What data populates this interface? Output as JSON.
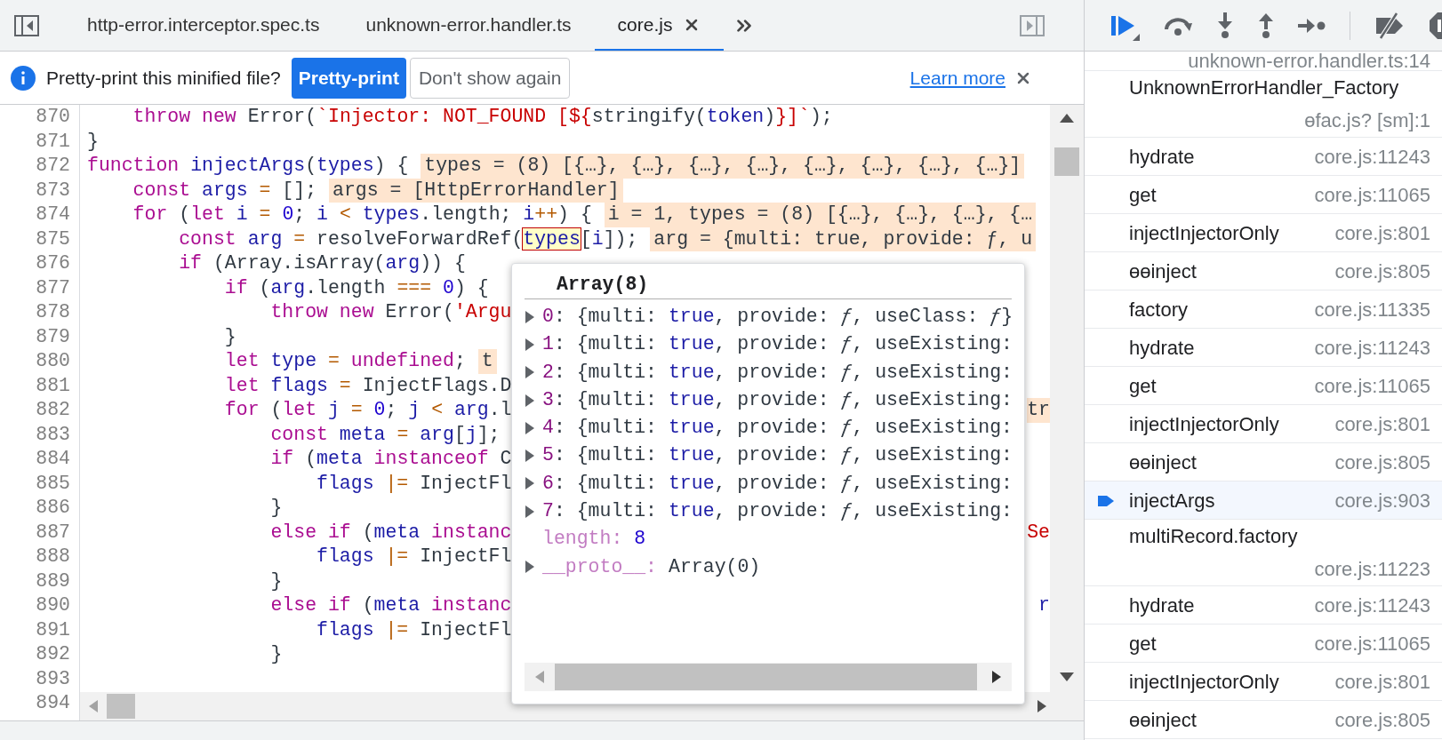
{
  "tabs": [
    {
      "label": "http-error.interceptor.spec.ts",
      "selected": false,
      "closable": false
    },
    {
      "label": "unknown-error.handler.ts",
      "selected": false,
      "closable": false
    },
    {
      "label": "core.js",
      "selected": true,
      "closable": true
    }
  ],
  "infobar": {
    "message": "Pretty-print this minified file?",
    "primary_button": "Pretty-print",
    "secondary_button": "Don't show again",
    "link": "Learn more"
  },
  "code": {
    "lines": [
      {
        "number": "870",
        "tokens": [
          {
            "kind": "k",
            "text": "    throw "
          },
          {
            "kind": "k",
            "text": "new"
          },
          {
            "kind": "p",
            "text": " Error("
          },
          {
            "kind": "s",
            "text": "`Injector: NOT_FOUND [${"
          },
          {
            "kind": "p",
            "text": "stringify("
          },
          {
            "kind": "v",
            "text": "token"
          },
          {
            "kind": "p",
            "text": ")"
          },
          {
            "kind": "s",
            "text": "}]`"
          },
          {
            "kind": "p",
            "text": ");"
          }
        ]
      },
      {
        "number": "871",
        "tokens": [
          {
            "kind": "p",
            "text": "}"
          }
        ]
      },
      {
        "number": "872",
        "tokens": [
          {
            "kind": "k",
            "text": "function "
          },
          {
            "kind": "v",
            "text": "injectArgs"
          },
          {
            "kind": "p",
            "text": "("
          },
          {
            "kind": "v",
            "text": "types"
          },
          {
            "kind": "p",
            "text": ") {"
          }
        ],
        "inline": "types = (8) [{…}, {…}, {…}, {…}, {…}, {…}, {…}, {…}]"
      },
      {
        "number": "873",
        "tokens": [
          {
            "kind": "k",
            "text": "    const "
          },
          {
            "kind": "v",
            "text": "args "
          },
          {
            "kind": "o",
            "text": "="
          },
          {
            "kind": "p",
            "text": " [];"
          }
        ],
        "inline": "args = [HttpErrorHandler]"
      },
      {
        "number": "874",
        "tokens": [
          {
            "kind": "k",
            "text": "    for"
          },
          {
            "kind": "p",
            "text": " ("
          },
          {
            "kind": "k",
            "text": "let "
          },
          {
            "kind": "v",
            "text": "i "
          },
          {
            "kind": "o",
            "text": "= "
          },
          {
            "kind": "n",
            "text": "0"
          },
          {
            "kind": "p",
            "text": "; "
          },
          {
            "kind": "v",
            "text": "i "
          },
          {
            "kind": "o",
            "text": "< "
          },
          {
            "kind": "v",
            "text": "types"
          },
          {
            "kind": "p",
            "text": ".length; "
          },
          {
            "kind": "v",
            "text": "i"
          },
          {
            "kind": "o",
            "text": "++"
          },
          {
            "kind": "p",
            "text": ") {"
          }
        ],
        "inline": "i = 1, types = (8) [{…}, {…}, {…}, {…"
      },
      {
        "number": "875",
        "tokens": [
          {
            "kind": "k",
            "text": "        const "
          },
          {
            "kind": "v",
            "text": "arg "
          },
          {
            "kind": "o",
            "text": "="
          },
          {
            "kind": "p",
            "text": " resolveForwardRef("
          },
          {
            "kind": "h",
            "text": "types"
          },
          {
            "kind": "p",
            "text": "["
          },
          {
            "kind": "v",
            "text": "i"
          },
          {
            "kind": "p",
            "text": "]);"
          }
        ],
        "inline": "arg = {multi: true, provide: ƒ, u"
      },
      {
        "number": "876",
        "tokens": [
          {
            "kind": "k",
            "text": "        if"
          },
          {
            "kind": "p",
            "text": " (Array.isArray("
          },
          {
            "kind": "v",
            "text": "arg"
          },
          {
            "kind": "p",
            "text": ")) {"
          }
        ]
      },
      {
        "number": "877",
        "tokens": [
          {
            "kind": "k",
            "text": "            if"
          },
          {
            "kind": "p",
            "text": " ("
          },
          {
            "kind": "v",
            "text": "arg"
          },
          {
            "kind": "p",
            "text": ".length "
          },
          {
            "kind": "o",
            "text": "=== "
          },
          {
            "kind": "n",
            "text": "0"
          },
          {
            "kind": "p",
            "text": ") {"
          }
        ]
      },
      {
        "number": "878",
        "tokens": [
          {
            "kind": "k",
            "text": "                throw "
          },
          {
            "kind": "k",
            "text": "new"
          },
          {
            "kind": "p",
            "text": " Error("
          },
          {
            "kind": "s",
            "text": "'Argu"
          }
        ]
      },
      {
        "number": "879",
        "tokens": [
          {
            "kind": "p",
            "text": "            }"
          }
        ]
      },
      {
        "number": "880",
        "tokens": [
          {
            "kind": "k",
            "text": "            let "
          },
          {
            "kind": "v",
            "text": "type "
          },
          {
            "kind": "o",
            "text": "= "
          },
          {
            "kind": "k",
            "text": "undefined"
          },
          {
            "kind": "p",
            "text": ";"
          }
        ],
        "inline": "t"
      },
      {
        "number": "881",
        "tokens": [
          {
            "kind": "k",
            "text": "            let "
          },
          {
            "kind": "v",
            "text": "flags "
          },
          {
            "kind": "o",
            "text": "="
          },
          {
            "kind": "p",
            "text": " InjectFlags.D"
          }
        ]
      },
      {
        "number": "882",
        "tokens": [
          {
            "kind": "k",
            "text": "            for"
          },
          {
            "kind": "p",
            "text": " ("
          },
          {
            "kind": "k",
            "text": "let "
          },
          {
            "kind": "v",
            "text": "j "
          },
          {
            "kind": "o",
            "text": "= "
          },
          {
            "kind": "n",
            "text": "0"
          },
          {
            "kind": "p",
            "text": "; "
          },
          {
            "kind": "v",
            "text": "j "
          },
          {
            "kind": "o",
            "text": "< "
          },
          {
            "kind": "v",
            "text": "arg"
          },
          {
            "kind": "p",
            "text": ".l"
          }
        ],
        "tail": {
          "kind": "i",
          "text": "tr"
        }
      },
      {
        "number": "883",
        "tokens": [
          {
            "kind": "k",
            "text": "                const "
          },
          {
            "kind": "v",
            "text": "meta "
          },
          {
            "kind": "o",
            "text": "= "
          },
          {
            "kind": "v",
            "text": "arg"
          },
          {
            "kind": "p",
            "text": "["
          },
          {
            "kind": "v",
            "text": "j"
          },
          {
            "kind": "p",
            "text": "];"
          }
        ]
      },
      {
        "number": "884",
        "tokens": [
          {
            "kind": "k",
            "text": "                if"
          },
          {
            "kind": "p",
            "text": " ("
          },
          {
            "kind": "v",
            "text": "meta "
          },
          {
            "kind": "k",
            "text": "instanceof"
          },
          {
            "kind": "p",
            "text": " C"
          }
        ]
      },
      {
        "number": "885",
        "tokens": [
          {
            "kind": "v",
            "text": "                    flags "
          },
          {
            "kind": "o",
            "text": "|="
          },
          {
            "kind": "p",
            "text": " InjectFl"
          }
        ]
      },
      {
        "number": "886",
        "tokens": [
          {
            "kind": "p",
            "text": "                }"
          }
        ]
      },
      {
        "number": "887",
        "tokens": [
          {
            "kind": "k",
            "text": "                else if"
          },
          {
            "kind": "p",
            "text": " ("
          },
          {
            "kind": "v",
            "text": "meta "
          },
          {
            "kind": "k",
            "text": "instanc"
          }
        ],
        "tail": {
          "kind": "s",
          "text": "Se"
        }
      },
      {
        "number": "888",
        "tokens": [
          {
            "kind": "v",
            "text": "                    flags "
          },
          {
            "kind": "o",
            "text": "|="
          },
          {
            "kind": "p",
            "text": " InjectFl"
          }
        ]
      },
      {
        "number": "889",
        "tokens": [
          {
            "kind": "p",
            "text": "                }"
          }
        ]
      },
      {
        "number": "890",
        "tokens": [
          {
            "kind": "k",
            "text": "                else if"
          },
          {
            "kind": "p",
            "text": " ("
          },
          {
            "kind": "v",
            "text": "meta "
          },
          {
            "kind": "k",
            "text": "instanc"
          }
        ],
        "tail": {
          "kind": "v",
          "text": "r"
        }
      },
      {
        "number": "891",
        "tokens": [
          {
            "kind": "v",
            "text": "                    flags "
          },
          {
            "kind": "o",
            "text": "|="
          },
          {
            "kind": "p",
            "text": " InjectFl"
          }
        ]
      },
      {
        "number": "892",
        "tokens": [
          {
            "kind": "p",
            "text": "                }"
          }
        ]
      },
      {
        "number": "893"
      },
      {
        "number": "894"
      }
    ]
  },
  "popup": {
    "title": "Array(8)",
    "entries": [
      {
        "key": "0",
        "expanded": false,
        "tokens": [
          {
            "kind": "p",
            "text": ": {multi: "
          },
          {
            "kind": "b",
            "text": "true"
          },
          {
            "kind": "p",
            "text": ", provide: "
          },
          {
            "kind": "f",
            "text": "ƒ"
          },
          {
            "kind": "p",
            "text": ", useClass: "
          },
          {
            "kind": "f",
            "text": "ƒ"
          },
          {
            "kind": "p",
            "text": "}"
          }
        ]
      },
      {
        "key": "1",
        "expanded": false,
        "tokens": [
          {
            "kind": "p",
            "text": ": {multi: "
          },
          {
            "kind": "b",
            "text": "true"
          },
          {
            "kind": "p",
            "text": ", provide: "
          },
          {
            "kind": "f",
            "text": "ƒ"
          },
          {
            "kind": "p",
            "text": ", useExisting:"
          }
        ]
      },
      {
        "key": "2",
        "expanded": false,
        "tokens": [
          {
            "kind": "p",
            "text": ": {multi: "
          },
          {
            "kind": "b",
            "text": "true"
          },
          {
            "kind": "p",
            "text": ", provide: "
          },
          {
            "kind": "f",
            "text": "ƒ"
          },
          {
            "kind": "p",
            "text": ", useExisting:"
          }
        ]
      },
      {
        "key": "3",
        "expanded": false,
        "tokens": [
          {
            "kind": "p",
            "text": ": {multi: "
          },
          {
            "kind": "b",
            "text": "true"
          },
          {
            "kind": "p",
            "text": ", provide: "
          },
          {
            "kind": "f",
            "text": "ƒ"
          },
          {
            "kind": "p",
            "text": ", useExisting:"
          }
        ]
      },
      {
        "key": "4",
        "expanded": false,
        "tokens": [
          {
            "kind": "p",
            "text": ": {multi: "
          },
          {
            "kind": "b",
            "text": "true"
          },
          {
            "kind": "p",
            "text": ", provide: "
          },
          {
            "kind": "f",
            "text": "ƒ"
          },
          {
            "kind": "p",
            "text": ", useExisting:"
          }
        ]
      },
      {
        "key": "5",
        "expanded": false,
        "tokens": [
          {
            "kind": "p",
            "text": ": {multi: "
          },
          {
            "kind": "b",
            "text": "true"
          },
          {
            "kind": "p",
            "text": ", provide: "
          },
          {
            "kind": "f",
            "text": "ƒ"
          },
          {
            "kind": "p",
            "text": ", useExisting:"
          }
        ]
      },
      {
        "key": "6",
        "expanded": false,
        "tokens": [
          {
            "kind": "p",
            "text": ": {multi: "
          },
          {
            "kind": "b",
            "text": "true"
          },
          {
            "kind": "p",
            "text": ", provide: "
          },
          {
            "kind": "f",
            "text": "ƒ"
          },
          {
            "kind": "p",
            "text": ", useExisting:"
          }
        ]
      },
      {
        "key": "7",
        "expanded": false,
        "tokens": [
          {
            "kind": "p",
            "text": ": {multi: "
          },
          {
            "kind": "b",
            "text": "true"
          },
          {
            "kind": "p",
            "text": ", provide: "
          },
          {
            "kind": "f",
            "text": "ƒ"
          },
          {
            "kind": "p",
            "text": ", useExisting:"
          }
        ]
      }
    ],
    "properties": [
      {
        "key": "length:",
        "value": "8",
        "kind": "number"
      },
      {
        "key": "__proto__:",
        "value": "Array(0)",
        "kind": "object"
      }
    ]
  },
  "call_stack": [
    {
      "location": "unknown-error.handler.ts:14",
      "selected": false
    },
    {
      "name": "UnknownErrorHandler_Factory",
      "location": "ɵfac.js? [sm]:1",
      "selected": false
    },
    {
      "name": "hydrate",
      "location": "core.js:11243",
      "selected": false
    },
    {
      "name": "get",
      "location": "core.js:11065",
      "selected": false
    },
    {
      "name": "injectInjectorOnly",
      "location": "core.js:801",
      "selected": false
    },
    {
      "name": "ɵɵinject",
      "location": "core.js:805",
      "selected": false
    },
    {
      "name": "factory",
      "location": "core.js:11335",
      "selected": false
    },
    {
      "name": "hydrate",
      "location": "core.js:11243",
      "selected": false
    },
    {
      "name": "get",
      "location": "core.js:11065",
      "selected": false
    },
    {
      "name": "injectInjectorOnly",
      "location": "core.js:801",
      "selected": false
    },
    {
      "name": "ɵɵinject",
      "location": "core.js:805",
      "selected": false
    },
    {
      "name": "injectArgs",
      "location": "core.js:903",
      "selected": true
    },
    {
      "name": "multiRecord.factory",
      "location": "core.js:11223",
      "selected": false
    },
    {
      "name": "hydrate",
      "location": "core.js:11243",
      "selected": false
    },
    {
      "name": "get",
      "location": "core.js:11065",
      "selected": false
    },
    {
      "name": "injectInjectorOnly",
      "location": "core.js:801",
      "selected": false
    },
    {
      "name": "ɵɵinject",
      "location": "core.js:805",
      "selected": false
    }
  ]
}
